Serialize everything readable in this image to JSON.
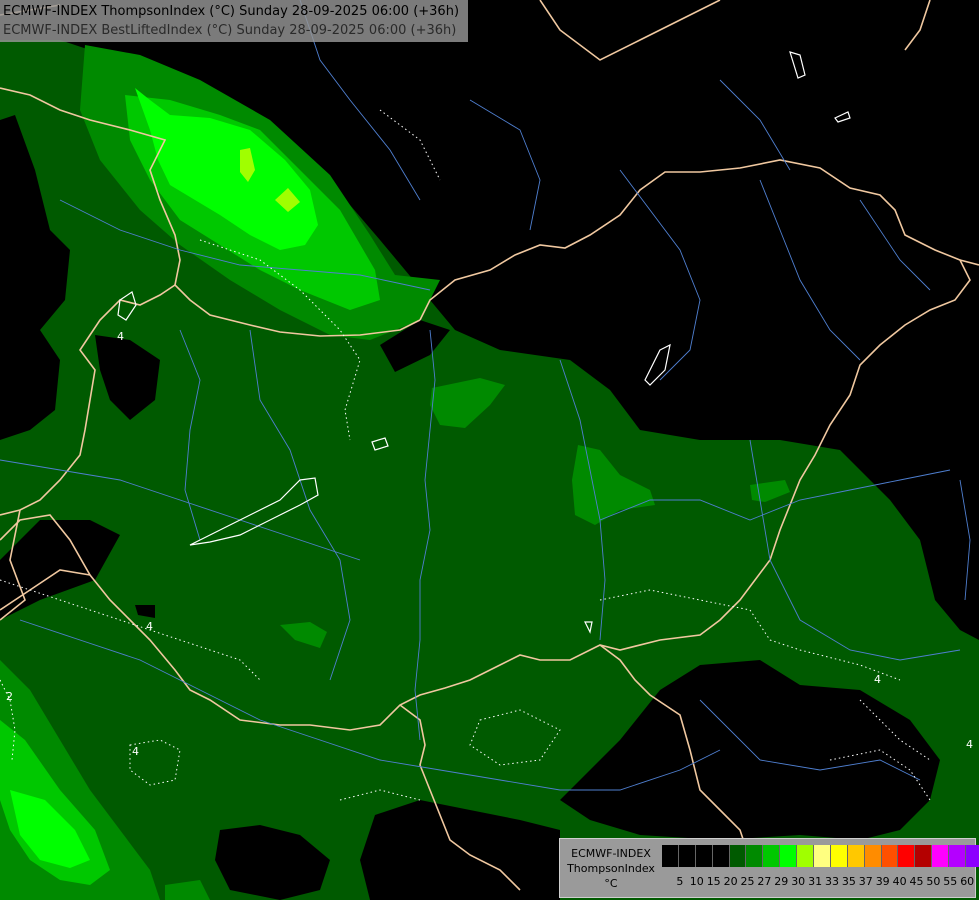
{
  "header": {
    "line1": "ECMWF-INDEX ThompsonIndex (°C) Sunday 28-09-2025 06:00 (+36h)",
    "line2": "ECMWF-INDEX BestLiftedIndex (°C) Sunday 28-09-2025 06:00 (+36h)"
  },
  "legend": {
    "label_line1": "ECMWF-INDEX",
    "label_line2": "ThompsonIndex",
    "label_line3": "°C",
    "colors": [
      "#000000",
      "#000000",
      "#000000",
      "#000000",
      "#005a00",
      "#008a00",
      "#00c800",
      "#00ff00",
      "#a0ff00",
      "#ffff80",
      "#ffff00",
      "#ffc800",
      "#ff8c00",
      "#ff5000",
      "#ff0000",
      "#b40000",
      "#ff00ff",
      "#b400ff",
      "#8c00ff",
      "#5000ff",
      "#0000ff"
    ],
    "ticks": [
      "5",
      "10",
      "15",
      "20",
      "25",
      "27",
      "29",
      "30",
      "31",
      "33",
      "35",
      "37",
      "39",
      "40",
      "45",
      "50",
      "55",
      "60"
    ]
  },
  "isolines": [
    "4",
    "4",
    "2",
    "4",
    "4",
    "4"
  ]
}
